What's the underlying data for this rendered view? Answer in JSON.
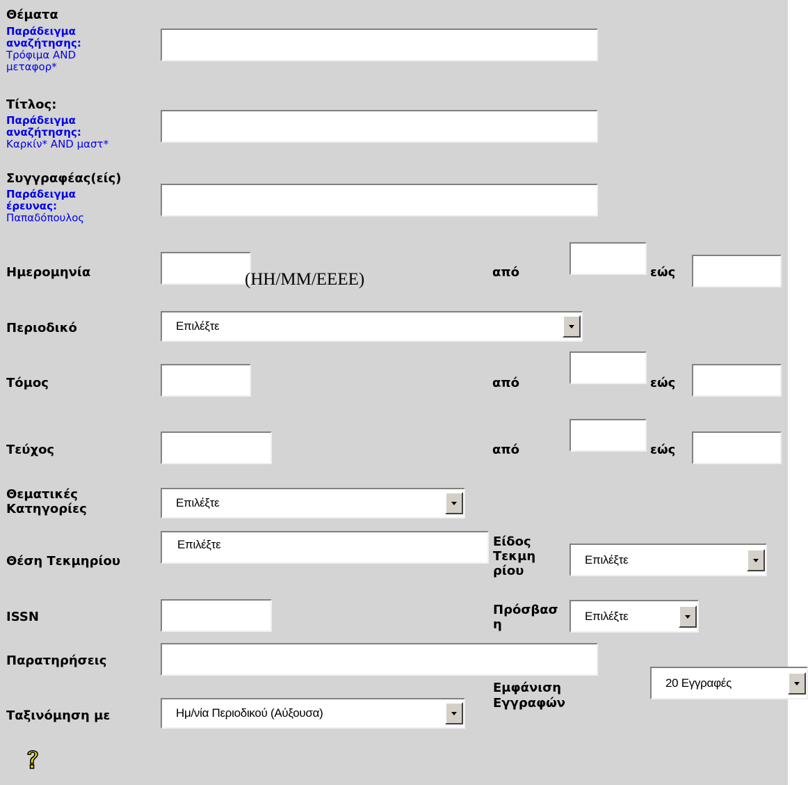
{
  "subjects": {
    "label": "Θέματα",
    "example_label": "Παράδειγμα αναζήτησης:",
    "example_text": "Τρόφιμα AND μεταφορ*",
    "value": ""
  },
  "title": {
    "label": "Τίτλος:",
    "example_label": "Παράδειγμα αναζήτησης:",
    "example_text": "Καρκίν* AND μαστ*",
    "value": ""
  },
  "authors": {
    "label": "Συγγραφέας(είς)",
    "example_label": "Παράδειγμα έρευνας:",
    "example_text": "Παπαδόπουλος",
    "value": ""
  },
  "date": {
    "label": "Ημερομηνία",
    "format_hint": "(HH/MM/EEEE)",
    "from_label": "από",
    "to_label": "εώς"
  },
  "journal": {
    "label": "Περιοδικό",
    "selected": "Επιλέξτε"
  },
  "volume": {
    "label": "Τόμος",
    "from_label": "από",
    "to_label": "εώς"
  },
  "issue": {
    "label": "Τεύχος",
    "from_label": "από",
    "to_label": "εώς"
  },
  "categories": {
    "label": "Θεματικές Κατηγορίες",
    "selected": "Επιλέξτε"
  },
  "location": {
    "label": "Θέση Τεκμηρίου",
    "value": "Επιλέξτε"
  },
  "item_type": {
    "label": "Είδος Τεκμηρίου",
    "selected": "Επιλέξτε"
  },
  "issn": {
    "label": "ISSN",
    "value": ""
  },
  "access": {
    "label": "Πρόσβαση",
    "selected": "Επιλέξτε"
  },
  "notes": {
    "label": "Παρατηρήσεις",
    "value": ""
  },
  "sort": {
    "label": "Ταξινόμηση με",
    "selected": "Ημ/νία Περιοδικού (Αύξουσα)"
  },
  "display": {
    "label": "Εμφάνιση Εγγραφών",
    "selected": "20 Εγγραφές"
  },
  "help": {
    "icon": "question-mark-icon",
    "glyph": "?"
  }
}
